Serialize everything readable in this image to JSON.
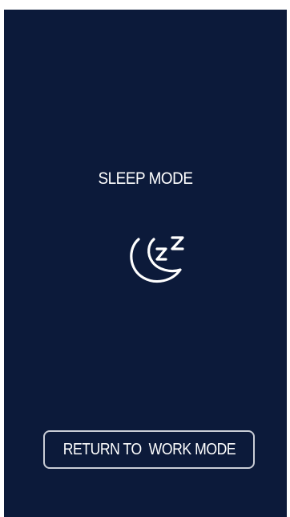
{
  "screen": {
    "title": "SLEEP MODE",
    "icon": "moon-sleep-icon",
    "background_color": "#0c1a3a",
    "return_button_label": "RETURN TO  WORK MODE"
  }
}
